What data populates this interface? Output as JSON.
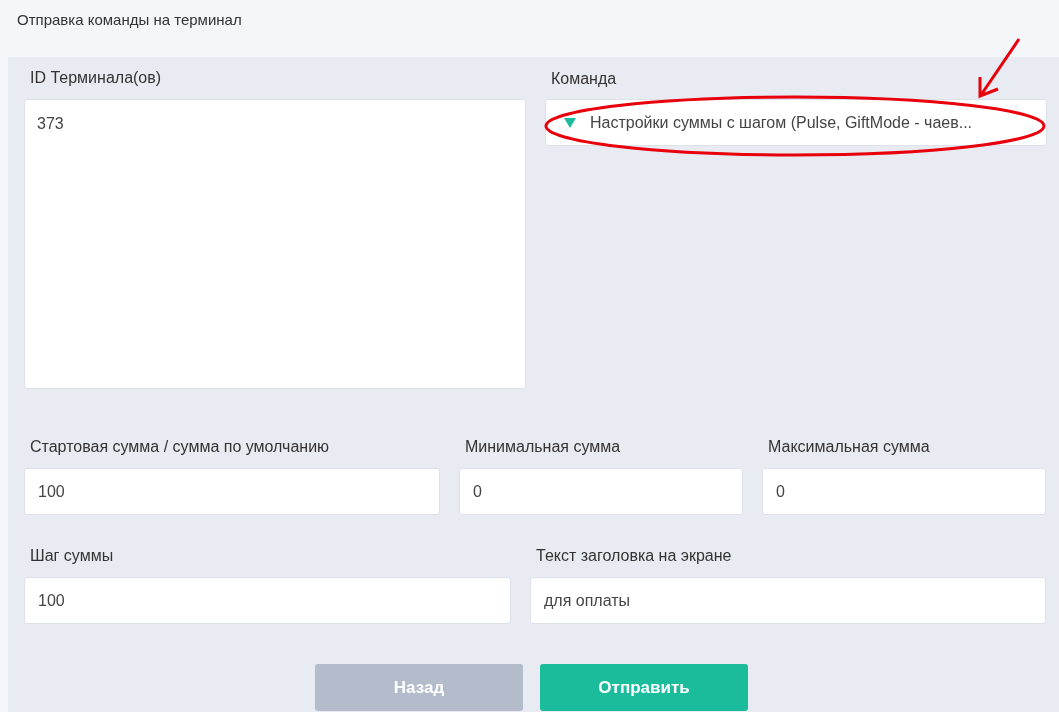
{
  "header": {
    "title": "Отправка команды на терминал"
  },
  "terminal_ids": {
    "label": "ID Терминала(ов)",
    "value": "373"
  },
  "command": {
    "label": "Команда",
    "value": "Настройки суммы с шагом (Pulse, GiftMode - чаев..."
  },
  "fields_row_1": [
    {
      "label": "Стартовая сумма / сумма по умолчанию",
      "value": "100"
    },
    {
      "label": "Минимальная сумма",
      "value": "0"
    },
    {
      "label": "Максимальная сумма",
      "value": "0"
    }
  ],
  "fields_row_2": [
    {
      "label": "Шаг суммы",
      "value": "100"
    },
    {
      "label": "Текст заголовка на экране",
      "value": "для оплаты"
    }
  ],
  "buttons": [
    {
      "label": "Назад",
      "disabled": true
    },
    {
      "label": "Отправить",
      "disabled": false
    }
  ]
}
